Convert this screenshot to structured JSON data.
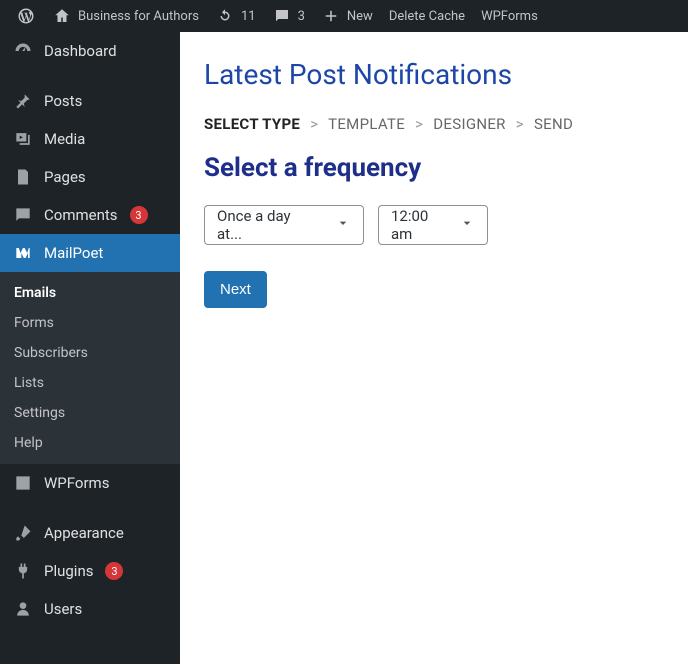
{
  "adminbar": {
    "site_name": "Business for Authors",
    "updates_count": "11",
    "comments_count": "3",
    "new_label": "New",
    "delete_cache_label": "Delete Cache",
    "wpforms_label": "WPForms"
  },
  "sidebar": {
    "items": [
      {
        "label": "Dashboard"
      },
      {
        "label": "Posts"
      },
      {
        "label": "Media"
      },
      {
        "label": "Pages"
      },
      {
        "label": "Comments",
        "badge": "3"
      },
      {
        "label": "MailPoet"
      },
      {
        "label": "WPForms"
      },
      {
        "label": "Appearance"
      },
      {
        "label": "Plugins",
        "badge": "3"
      },
      {
        "label": "Users"
      }
    ],
    "mailpoet_submenu": [
      {
        "label": "Emails",
        "current": true
      },
      {
        "label": "Forms"
      },
      {
        "label": "Subscribers"
      },
      {
        "label": "Lists"
      },
      {
        "label": "Settings"
      },
      {
        "label": "Help"
      }
    ]
  },
  "main": {
    "page_title": "Latest Post Notifications",
    "breadcrumb": {
      "steps": [
        "SELECT TYPE",
        "TEMPLATE",
        "DESIGNER",
        "SEND"
      ],
      "active_index": 0,
      "sep": ">"
    },
    "section_heading": "Select a frequency",
    "frequency_value": "Once a day at...",
    "time_value": "12:00 am",
    "next_label": "Next"
  }
}
